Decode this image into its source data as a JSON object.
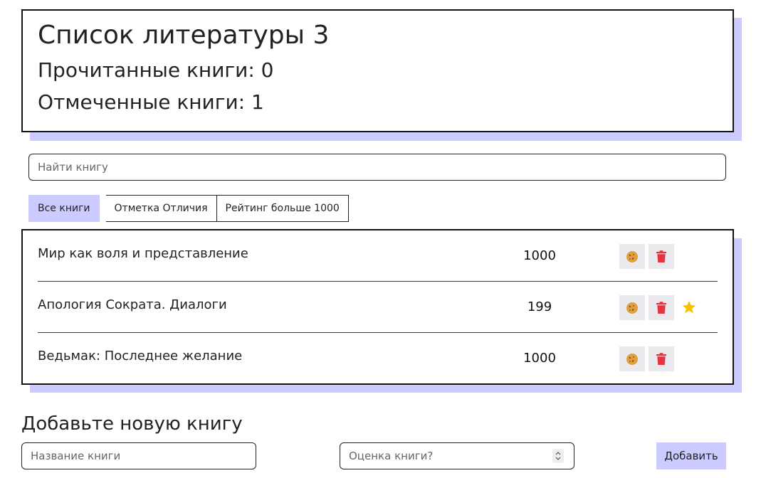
{
  "header": {
    "title": "Список литературы 3",
    "read_books": "Прочитанные книги: 0",
    "marked_books": "Отмеченные книги: 1"
  },
  "search": {
    "placeholder": "Найти книгу"
  },
  "filters": [
    "Все книги",
    "Отметка Отличия",
    "Рейтинг больше 1000"
  ],
  "books": [
    {
      "name": "Мир как воля и представление",
      "rating": "1000",
      "starred": false
    },
    {
      "name": "Апология Сократа. Диалоги",
      "rating": "199",
      "starred": true
    },
    {
      "name": "Ведьмак: Последнее желание",
      "rating": "1000",
      "starred": false
    }
  ],
  "icons": {
    "cookie": "cookie-icon",
    "delete": "trash-icon",
    "star": "star-icon"
  },
  "colors": {
    "accent": "#cccbff",
    "cookie": "#e0a040",
    "delete": "#e5343d",
    "star": "#f5c400",
    "divider": "#2b3f5c"
  },
  "add_form": {
    "title": "Добавьте новую книгу",
    "name_placeholder": "Название книги",
    "rating_placeholder": "Оценка книги?",
    "submit_label": "Добавить"
  }
}
